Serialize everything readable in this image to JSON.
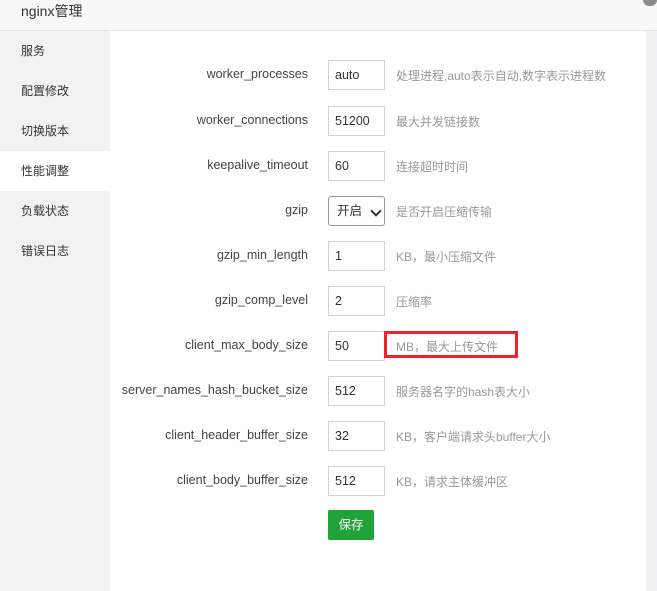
{
  "window": {
    "title": "nginx管理"
  },
  "sidebar": {
    "items": [
      {
        "label": "服务",
        "active": false
      },
      {
        "label": "配置修改",
        "active": false
      },
      {
        "label": "切换版本",
        "active": false
      },
      {
        "label": "性能调整",
        "active": true
      },
      {
        "label": "负载状态",
        "active": false
      },
      {
        "label": "错误日志",
        "active": false
      }
    ]
  },
  "form": {
    "rows": [
      {
        "name": "worker_processes",
        "value": "auto",
        "desc": "处理进程,auto表示自动,数字表示进程数",
        "type": "input"
      },
      {
        "name": "worker_connections",
        "value": "51200",
        "desc": "最大并发链接数",
        "type": "input"
      },
      {
        "name": "keepalive_timeout",
        "value": "60",
        "desc": "连接超时时间",
        "type": "input"
      },
      {
        "name": "gzip",
        "value": "开启",
        "desc": "是否开启压缩传输",
        "type": "select"
      },
      {
        "name": "gzip_min_length",
        "value": "1",
        "desc": "KB，最小压缩文件",
        "type": "input"
      },
      {
        "name": "gzip_comp_level",
        "value": "2",
        "desc": "压缩率",
        "type": "input"
      },
      {
        "name": "client_max_body_size",
        "value": "50",
        "desc": "MB，最大上传文件",
        "type": "input",
        "highlighted": true
      },
      {
        "name": "server_names_hash_bucket_size",
        "value": "512",
        "desc": "服务器名字的hash表大小",
        "type": "input"
      },
      {
        "name": "client_header_buffer_size",
        "value": "32",
        "desc": "KB，客户端请求头buffer大小",
        "type": "input"
      },
      {
        "name": "client_body_buffer_size",
        "value": "512",
        "desc": "KB，请求主体缓冲区",
        "type": "input"
      }
    ],
    "save_label": "保存"
  },
  "colors": {
    "save_button": "#21a337",
    "highlight_box": "#e8232e",
    "sidebar_bg": "#f2f2f2"
  }
}
